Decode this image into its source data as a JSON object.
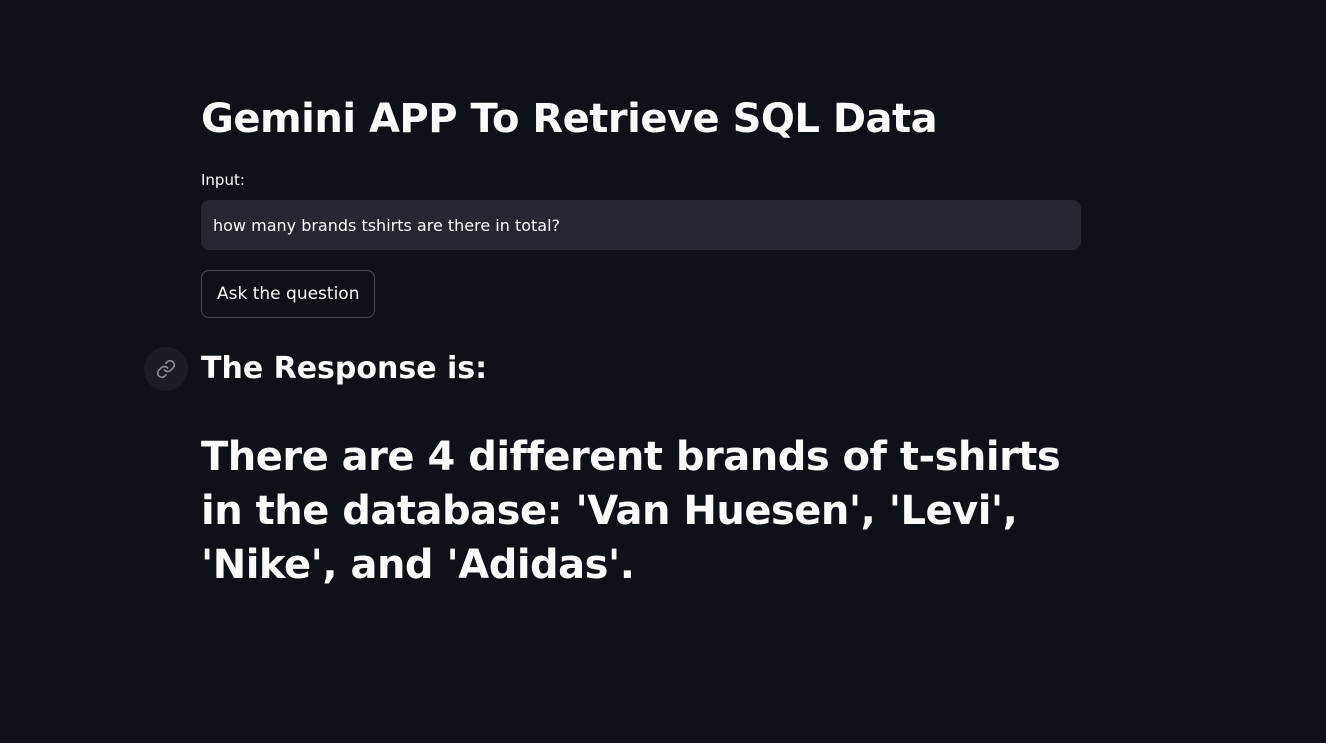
{
  "page": {
    "title": "Gemini APP To Retrieve SQL Data"
  },
  "form": {
    "input_label": "Input:",
    "input_value": "how many brands tshirts are there in total?",
    "button_label": "Ask the question"
  },
  "response": {
    "header": "The Response is:",
    "text": "There are 4 different brands of t-shirts in the database: 'Van Huesen', 'Levi', 'Nike', and 'Adidas'."
  },
  "colors": {
    "background": "#0e1117",
    "input_background": "#262730",
    "text": "#fafafa"
  },
  "icons": {
    "anchor": "link-icon"
  }
}
